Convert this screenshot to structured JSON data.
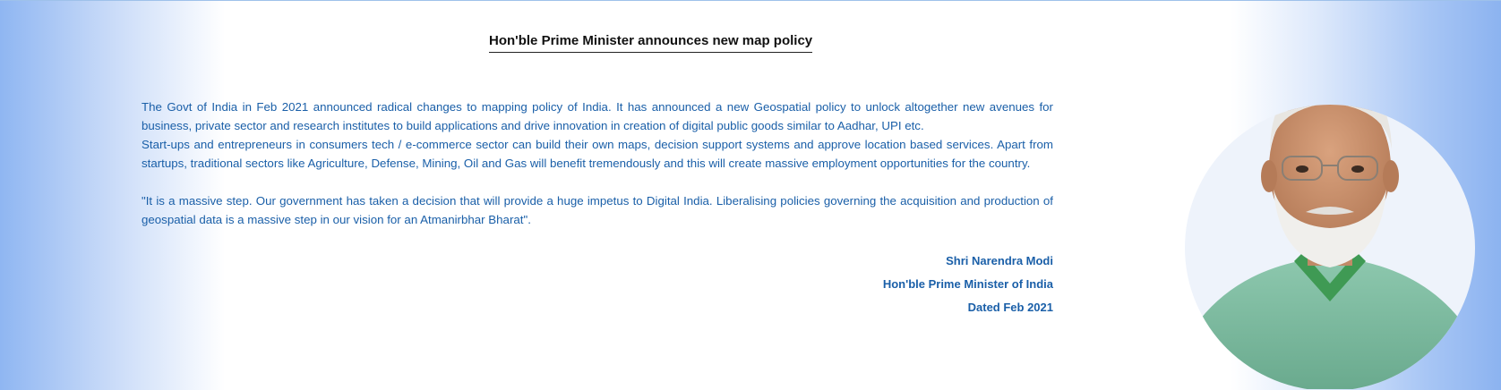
{
  "announcement": {
    "title": "Hon'ble Prime Minister announces new map policy",
    "paragraph_1": "The Govt of India in Feb 2021 announced radical changes to mapping policy of India. It has announced a new Geospatial policy to unlock altogether new avenues for business, private sector and research institutes to build applications and drive innovation in creation of digital public goods similar to Aadhar, UPI etc.",
    "paragraph_2": "Start-ups and entrepreneurs in consumers tech / e-commerce sector can build their own maps, decision support systems and approve location based services. Apart from startups, traditional sectors like Agriculture, Defense, Mining, Oil and Gas will benefit tremendously and this will create massive employment opportunities for the country.",
    "quote": "\"It is a massive step. Our government has taken a decision that will provide a huge impetus to Digital India. Liberalising policies governing the acquisition and production of geospatial data is a massive step in our vision for an Atmanirbhar Bharat\"."
  },
  "signature": {
    "name": "Shri Narendra Modi",
    "designation": "Hon'ble Prime Minister of India",
    "date": "Dated Feb 2021"
  },
  "colors": {
    "text_blue": "#1a5fa8",
    "banner_gradient_edge": "#8fb6f2",
    "title_text": "#111111"
  }
}
